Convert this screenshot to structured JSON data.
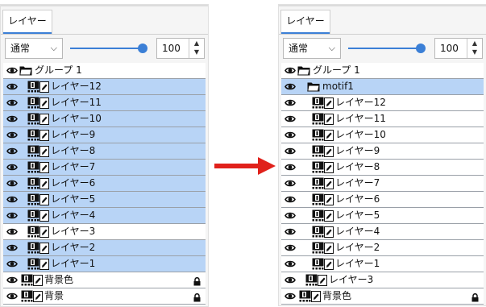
{
  "left": {
    "tab": "レイヤー",
    "blend_mode": "通常",
    "opacity": "100",
    "rows": [
      {
        "label": "グループ 1",
        "kind": "group",
        "selected": false
      },
      {
        "label": "レイヤー12",
        "kind": "layer",
        "selected": true
      },
      {
        "label": "レイヤー11",
        "kind": "layer",
        "selected": true
      },
      {
        "label": "レイヤー10",
        "kind": "layer",
        "selected": true
      },
      {
        "label": "レイヤー9",
        "kind": "layer",
        "selected": true
      },
      {
        "label": "レイヤー8",
        "kind": "layer",
        "selected": true
      },
      {
        "label": "レイヤー7",
        "kind": "layer",
        "selected": true
      },
      {
        "label": "レイヤー6",
        "kind": "layer",
        "selected": true
      },
      {
        "label": "レイヤー5",
        "kind": "layer",
        "selected": true
      },
      {
        "label": "レイヤー4",
        "kind": "layer",
        "selected": true
      },
      {
        "label": "レイヤー3",
        "kind": "layer",
        "selected": false
      },
      {
        "label": "レイヤー2",
        "kind": "layer",
        "selected": true
      },
      {
        "label": "レイヤー1",
        "kind": "layer",
        "selected": true
      },
      {
        "label": "背景色",
        "kind": "base",
        "selected": false,
        "locked": true
      },
      {
        "label": "背景",
        "kind": "base",
        "selected": false,
        "locked": true
      }
    ]
  },
  "right": {
    "tab": "レイヤー",
    "blend_mode": "通常",
    "opacity": "100",
    "rows": [
      {
        "label": "グループ 1",
        "kind": "group",
        "selected": false
      },
      {
        "label": "motif1",
        "kind": "subgroup",
        "selected": true
      },
      {
        "label": "レイヤー12",
        "kind": "nested",
        "selected": false
      },
      {
        "label": "レイヤー11",
        "kind": "nested",
        "selected": false
      },
      {
        "label": "レイヤー10",
        "kind": "nested",
        "selected": false
      },
      {
        "label": "レイヤー9",
        "kind": "nested",
        "selected": false
      },
      {
        "label": "レイヤー8",
        "kind": "nested",
        "selected": false
      },
      {
        "label": "レイヤー7",
        "kind": "nested",
        "selected": false
      },
      {
        "label": "レイヤー6",
        "kind": "nested",
        "selected": false
      },
      {
        "label": "レイヤー5",
        "kind": "nested",
        "selected": false
      },
      {
        "label": "レイヤー4",
        "kind": "nested",
        "selected": false
      },
      {
        "label": "レイヤー2",
        "kind": "nested",
        "selected": false
      },
      {
        "label": "レイヤー1",
        "kind": "nested",
        "selected": false
      },
      {
        "label": "レイヤー3",
        "kind": "layer",
        "selected": false
      },
      {
        "label": "背景色",
        "kind": "base",
        "selected": false,
        "locked": true
      },
      {
        "label": "背景",
        "kind": "base",
        "selected": false,
        "locked": true
      }
    ]
  },
  "colors": {
    "selected_row": "#b8d4f6",
    "accent": "#3b7fd6",
    "arrow": "#e0211b"
  },
  "icons": {
    "visibility": "eye-icon",
    "layer_thumb": "layer-thumbnail-icon",
    "edit": "pencil-icon",
    "group": "folder-icon",
    "lock": "lock-icon",
    "dropdown": "chevron-down-icon",
    "spinner": "spinner-arrows-icon",
    "transition": "right-arrow-icon"
  }
}
